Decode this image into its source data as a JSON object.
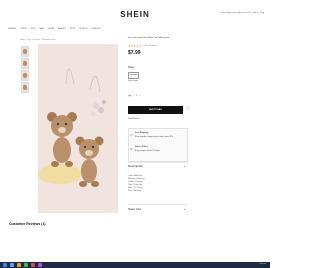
{
  "header": {
    "brand": "SHEIN",
    "right_text": "Free shipping on orders over $29 · Sign in · Bag",
    "nav": [
      "WOMEN",
      "CURVE",
      "KIDS",
      "MEN",
      "HOME",
      "BEAUTY",
      "PETS",
      "SPORTS",
      "JEWELRY"
    ]
  },
  "breadcrumb": "Home / Toys & Games / Stuffed Animals",
  "product": {
    "title": "1pc Cute Couple Bear Plush Toy Doll Keychain",
    "rating_text": "(100+ Reviews)",
    "stars": "★★★★★",
    "price": "$7.99"
  },
  "size": {
    "label": "Size:",
    "option": "one-size",
    "guide": "Size Guide"
  },
  "quantity": {
    "label": "Qty",
    "minus": "−",
    "value": "1",
    "plus": "+"
  },
  "add_to_bag": "ADD TO BAG",
  "shipping_note": "Free Returns",
  "info_rows": [
    {
      "icon": "truck-icon",
      "title": "Free Shipping",
      "text": "Free standard shipping on orders over $29"
    },
    {
      "icon": "return-icon",
      "title": "Return Policy",
      "text": "Easy returns within 35 days"
    }
  ],
  "description": {
    "label": "Description",
    "plus": "+"
  },
  "attributes": [
    "Color: Multicolor",
    "Material: Polyester",
    "Pattern: Cartoon",
    "Type: Plush Toy",
    "Filler: PP Cotton",
    "Size: One-size"
  ],
  "store": {
    "label": "Store Info",
    "plus": "+"
  },
  "reviews_heading": "Customer Reviews (1)"
}
